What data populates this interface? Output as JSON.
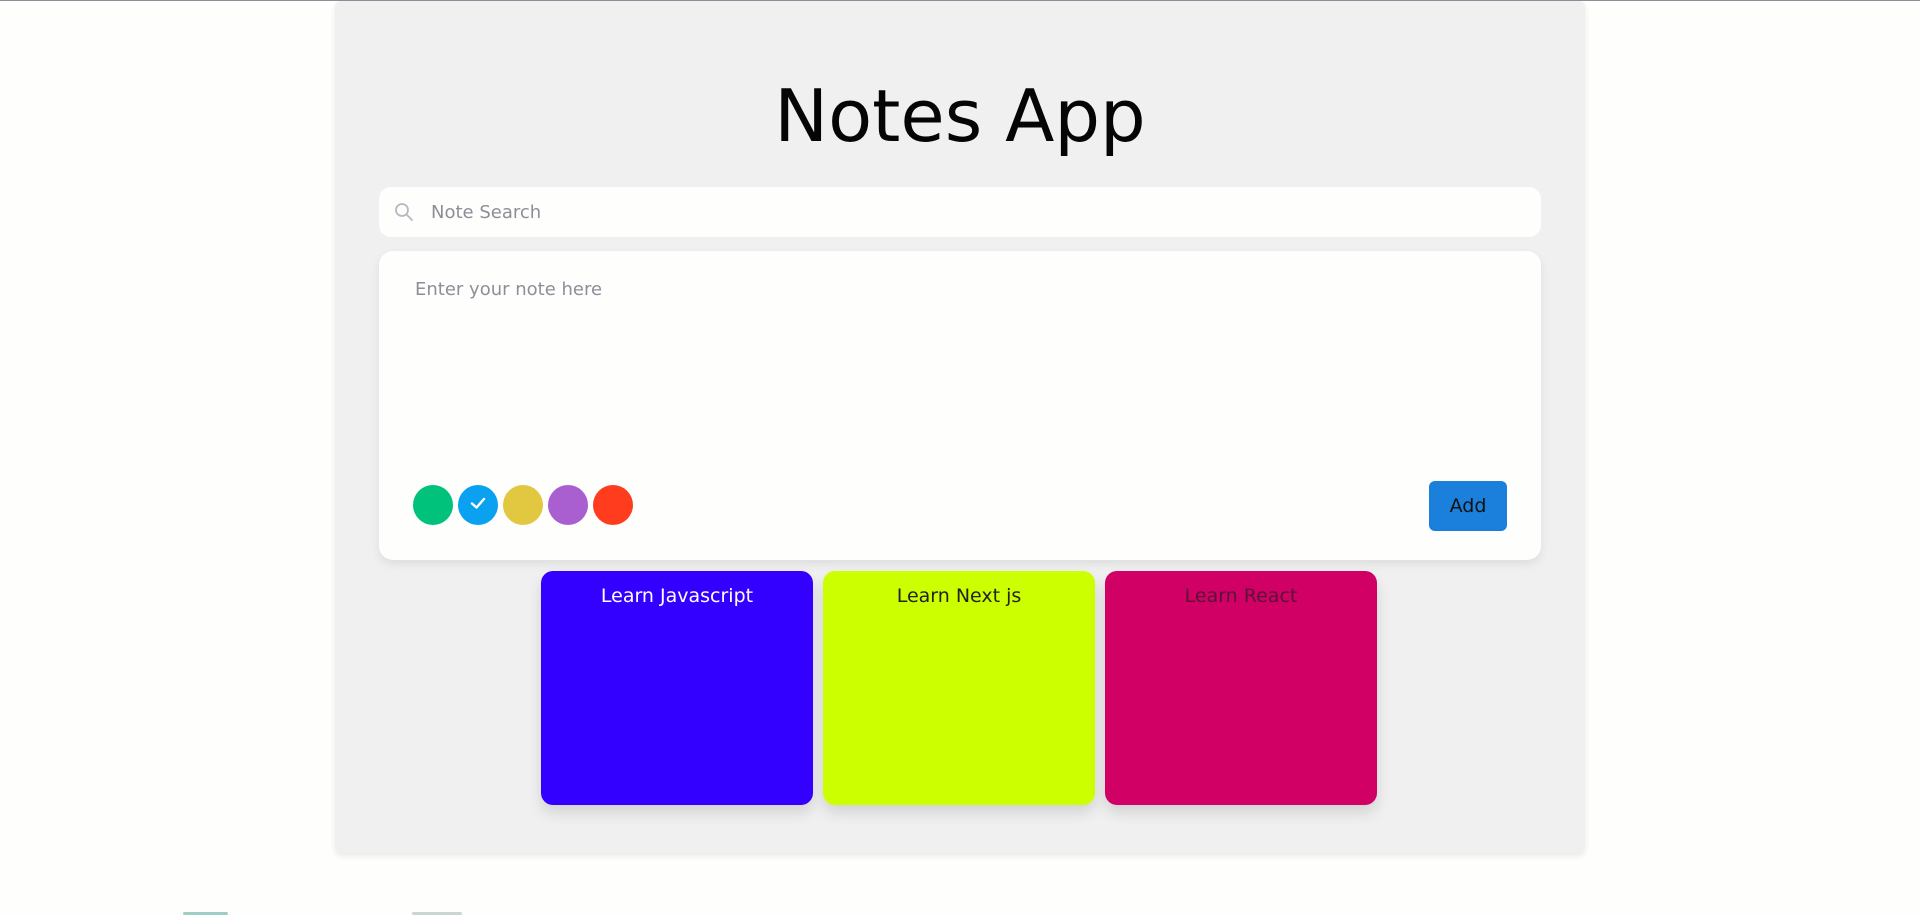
{
  "app": {
    "title": "Notes App"
  },
  "search": {
    "placeholder": "Note Search",
    "value": "",
    "icon": "search-icon"
  },
  "composer": {
    "placeholder": "Enter your note here",
    "value": "",
    "add_label": "Add",
    "add_color": "#1b80dc",
    "colors": [
      {
        "name": "green",
        "hex": "#00c27a",
        "selected": false
      },
      {
        "name": "blue",
        "hex": "#0aa2f0",
        "selected": true
      },
      {
        "name": "yellow",
        "hex": "#e2c741",
        "selected": false
      },
      {
        "name": "purple",
        "hex": "#a95fcf",
        "selected": false
      },
      {
        "name": "red",
        "hex": "#ff3c1e",
        "selected": false
      }
    ]
  },
  "notes": [
    {
      "text": "Learn Javascript",
      "bg": "#3300ff",
      "fg": "#ffffff"
    },
    {
      "text": "Learn Next js",
      "bg": "#ccff00",
      "fg": "#222222"
    },
    {
      "text": "Learn React",
      "bg": "#d10065",
      "fg": "#5a1238"
    }
  ]
}
